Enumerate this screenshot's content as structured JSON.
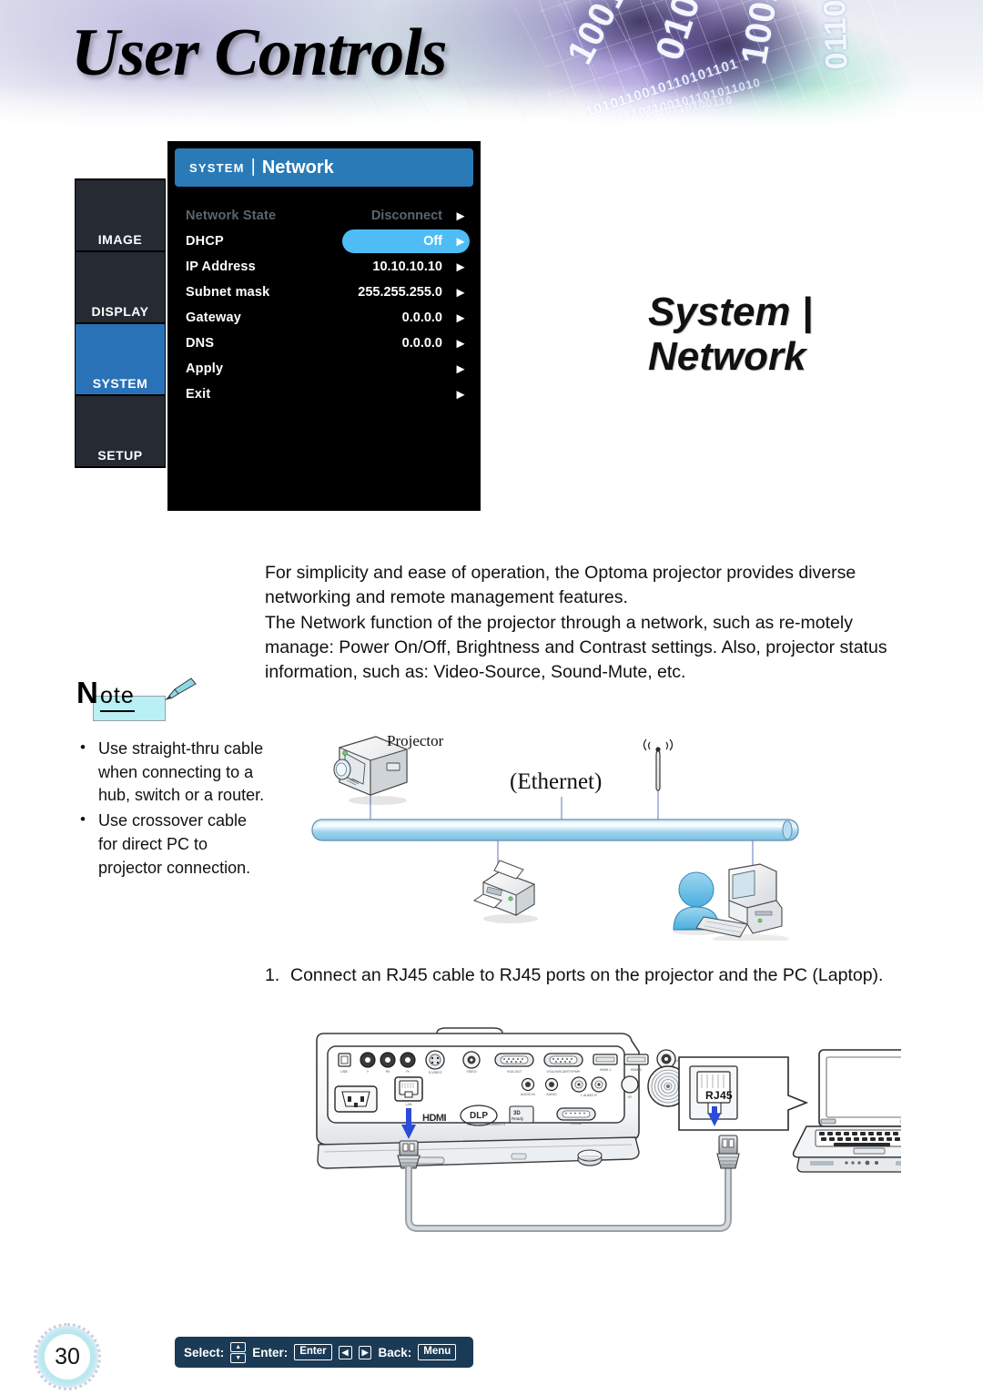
{
  "header": {
    "title": "User Controls"
  },
  "side_title": {
    "line1": "System |",
    "line2": "Network"
  },
  "osd": {
    "tabs": [
      {
        "label": "IMAGE",
        "active": false
      },
      {
        "label": "DISPLAY",
        "active": false
      },
      {
        "label": "SYSTEM",
        "active": true
      },
      {
        "label": "SETUP",
        "active": false
      }
    ],
    "header": {
      "category": "SYSTEM",
      "separator": "|",
      "page": "Network"
    },
    "rows": [
      {
        "label": "Network State",
        "value": "Disconnect",
        "state": "disabled"
      },
      {
        "label": "DHCP",
        "value": "Off",
        "state": "highlighted"
      },
      {
        "label": "IP Address",
        "value": "10.10.10.10",
        "state": "normal"
      },
      {
        "label": "Subnet mask",
        "value": "255.255.255.0",
        "state": "normal"
      },
      {
        "label": "Gateway",
        "value": "0.0.0.0",
        "state": "normal"
      },
      {
        "label": "DNS",
        "value": "0.0.0.0",
        "state": "normal"
      },
      {
        "label": "Apply",
        "value": "",
        "state": "normal"
      },
      {
        "label": "Exit",
        "value": "",
        "state": "normal"
      }
    ],
    "footer": {
      "select_label": "Select:",
      "enter_label": "Enter:",
      "enter_key": "Enter",
      "back_label": "Back:",
      "menu_key": "Menu"
    },
    "colors": {
      "header_blue": "#2a7ab8",
      "tab_active_blue": "#2a72b8",
      "highlight_blue": "#4fbdf5",
      "footer_navy": "#1b3a55",
      "panel_black": "#000000",
      "tab_inactive": "#262b33",
      "disabled_text": "#5a6670"
    }
  },
  "body": {
    "paragraph1": "For simplicity and ease of operation, the Optoma projector provides diverse networking and remote management features.",
    "paragraph2": "The Network function of the projector through a network, such as re-motely manage:  Power On/Off, Brightness and Contrast settings. Also, projector status information, such as: Video-Source, Sound-Mute, etc."
  },
  "note": {
    "title_cap": "N",
    "title_rest": "ote",
    "items": [
      "Use straight-thru cable when connecting to a hub, switch or a router.",
      "Use crossover cable for direct PC to projector connection."
    ]
  },
  "diagram": {
    "projector_label": "Projector",
    "ethernet_label": "(Ethernet)",
    "bus_color": "#a8d8ee"
  },
  "step1": {
    "number": "1.",
    "text": "Connect an RJ45 cable to RJ45 ports on the projector and the PC (Laptop)."
  },
  "bottom_diagram": {
    "rj45_label": "RJ45",
    "arrow_color": "#2b4bd8",
    "port_labels": [
      "USB",
      "Y",
      "Pb",
      "Pr",
      "S-VIDEO",
      "VIDEO",
      "VGA-OUT",
      "VGA1-IN / SCART / YPbPr",
      "HDMI 1",
      "HDMI 2",
      "12V OUT",
      "AUDIO IN",
      "AUDIO",
      "L AUDIO R",
      "RS-232",
      "LAN"
    ],
    "brand_marks": [
      "HDMI",
      "DLP",
      "3D Ready"
    ]
  },
  "page_number": "30"
}
